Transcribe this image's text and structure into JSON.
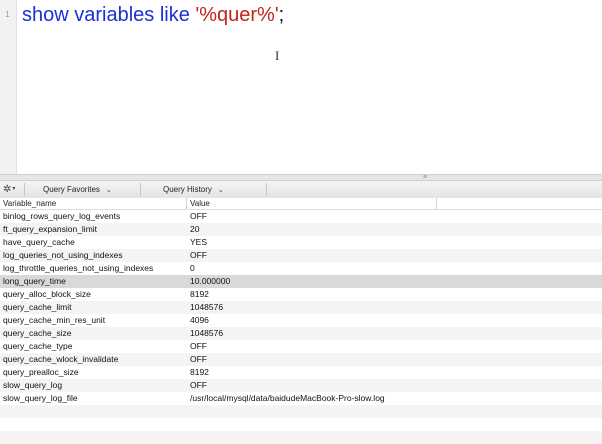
{
  "editor": {
    "line_number": "1",
    "query": {
      "keyword": "show variables like ",
      "string": "'%quer%'",
      "terminator": ";"
    },
    "cursor_glyph": "I"
  },
  "splitter": {
    "grip": "≡"
  },
  "toolbar": {
    "gear": "✲",
    "gear_dropdown": "▾",
    "favorites_label": "Query Favorites",
    "favorites_chevron": "⌄",
    "history_label": "Query History",
    "history_chevron": "⌄"
  },
  "results": {
    "columns": [
      "Variable_name",
      "Value"
    ],
    "rows": [
      [
        "binlog_rows_query_log_events",
        "OFF"
      ],
      [
        "ft_query_expansion_limit",
        "20"
      ],
      [
        "have_query_cache",
        "YES"
      ],
      [
        "log_queries_not_using_indexes",
        "OFF"
      ],
      [
        "log_throttle_queries_not_using_indexes",
        "0"
      ],
      [
        "long_query_time",
        "10.000000"
      ],
      [
        "query_alloc_block_size",
        "8192"
      ],
      [
        "query_cache_limit",
        "1048576"
      ],
      [
        "query_cache_min_res_unit",
        "4096"
      ],
      [
        "query_cache_size",
        "1048576"
      ],
      [
        "query_cache_type",
        "OFF"
      ],
      [
        "query_cache_wlock_invalidate",
        "OFF"
      ],
      [
        "query_prealloc_size",
        "8192"
      ],
      [
        "slow_query_log",
        "OFF"
      ],
      [
        "slow_query_log_file",
        "/usr/local/mysql/data/baidudeMacBook-Pro-slow.log"
      ]
    ],
    "selected_row": 5
  }
}
